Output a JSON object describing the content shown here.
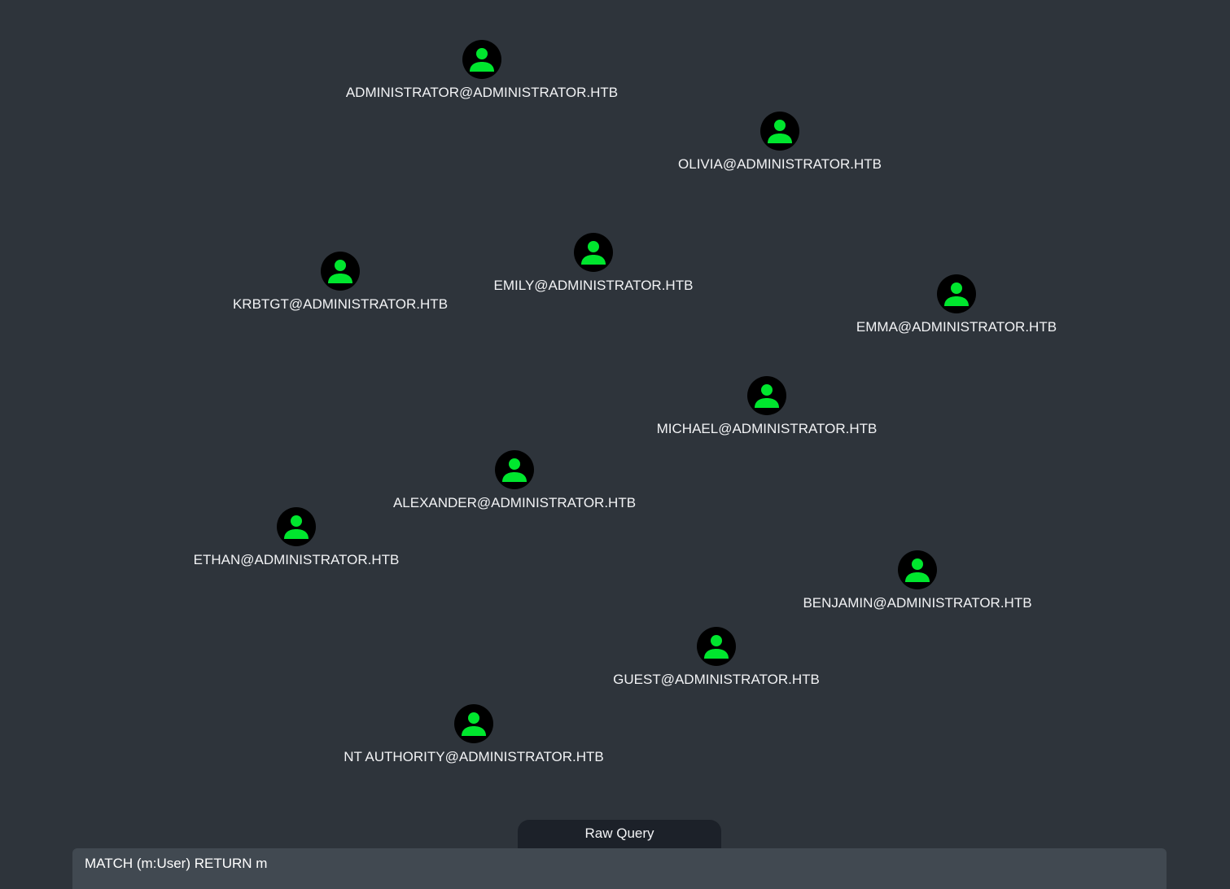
{
  "colors": {
    "background": "#2e343b",
    "node_fill": "#000000",
    "user_icon": "#00e62e",
    "label_text": "#f2f3f5",
    "query_tab": "#1c2129",
    "query_bar": "#414951"
  },
  "node_icon": "user-icon",
  "nodes": [
    {
      "id": "administrator",
      "label": "ADMINISTRATOR@ADMINISTRATOR.HTB"
    },
    {
      "id": "olivia",
      "label": "OLIVIA@ADMINISTRATOR.HTB"
    },
    {
      "id": "krbtgt",
      "label": "KRBTGT@ADMINISTRATOR.HTB"
    },
    {
      "id": "emily",
      "label": "EMILY@ADMINISTRATOR.HTB"
    },
    {
      "id": "emma",
      "label": "EMMA@ADMINISTRATOR.HTB"
    },
    {
      "id": "michael",
      "label": "MICHAEL@ADMINISTRATOR.HTB"
    },
    {
      "id": "alexander",
      "label": "ALEXANDER@ADMINISTRATOR.HTB"
    },
    {
      "id": "ethan",
      "label": "ETHAN@ADMINISTRATOR.HTB"
    },
    {
      "id": "benjamin",
      "label": "BENJAMIN@ADMINISTRATOR.HTB"
    },
    {
      "id": "guest",
      "label": "GUEST@ADMINISTRATOR.HTB"
    },
    {
      "id": "ntauthority",
      "label": "NT AUTHORITY@ADMINISTRATOR.HTB"
    }
  ],
  "raw_query": {
    "tab_label": "Raw Query",
    "value": "MATCH (m:User) RETURN m"
  }
}
